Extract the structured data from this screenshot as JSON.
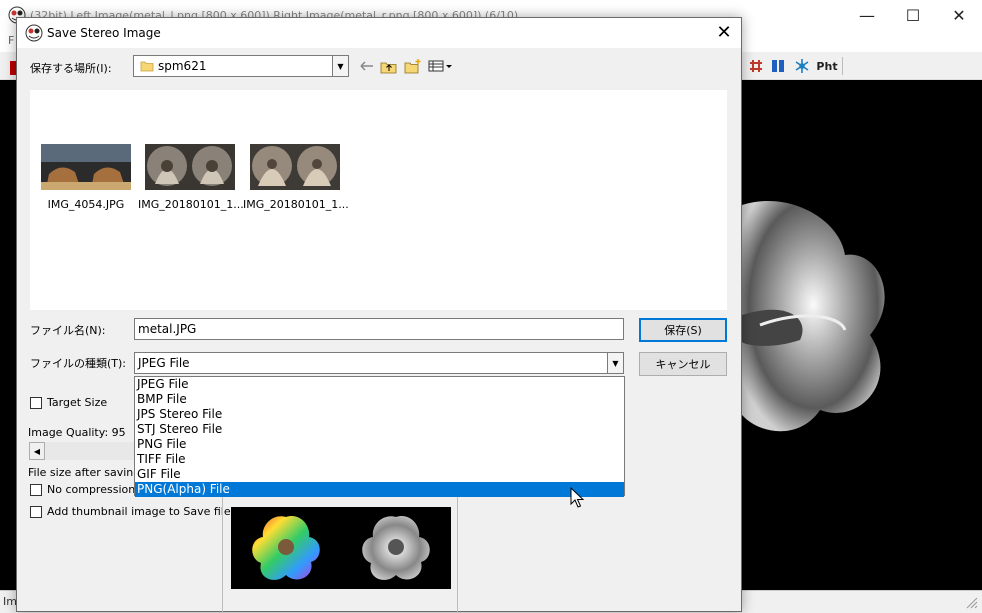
{
  "background_window": {
    "title": "(32bit) Left Image(metal_l.png [800 x 600]) Right Image(metal_r.png [800 x 600]) (6/10)",
    "menu_first_letter": "F",
    "toolbar_text_button": "Pht",
    "status_text": "Im",
    "controls": {
      "minimize": "—",
      "maximize": "☐",
      "close": "✕"
    }
  },
  "dialog": {
    "title": "Save Stereo Image",
    "close_glyph": "✕",
    "lookin_label": "保存する場所(I):",
    "lookin_value": "spm621",
    "files": [
      {
        "name": "IMG_4054.JPG"
      },
      {
        "name": "IMG_20180101_1..."
      },
      {
        "name": "IMG_20180101_1..."
      }
    ],
    "filename_label": "ファイル名(N):",
    "filename_value": "metal.JPG",
    "filetype_label": "ファイルの種類(T):",
    "filetype_value": "JPEG File",
    "save_button": "保存(S)",
    "cancel_button": "キャンセル",
    "filetype_options": [
      "JPEG File",
      "BMP File",
      "JPS Stereo File",
      "STJ Stereo File",
      "PNG File",
      "TIFF File",
      "GIF File",
      "PNG(Alpha) File"
    ],
    "selected_option_index": 7,
    "target_size_label": "Target Size",
    "image_quality_label": "Image Quality: 95",
    "file_size_label": "File size after saving :",
    "no_compression_label": "No compression gl",
    "add_thumbnail_label": "Add thumbnail image to Save file"
  },
  "colors": {
    "selection": "#0078d7",
    "default_button_border": "#0078d7",
    "canvas_bg": "#000000"
  },
  "icons": [
    "app-icon",
    "folder-icon",
    "back-arrow-icon",
    "up-folder-icon",
    "new-folder-icon",
    "view-menu-icon",
    "grid-icon",
    "pause-icon",
    "snowflake-icon",
    "mouse-cursor-icon"
  ]
}
